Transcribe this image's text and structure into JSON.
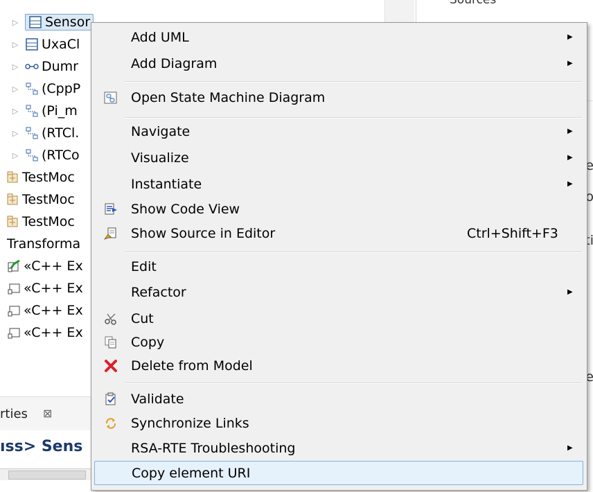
{
  "tree": {
    "items": [
      {
        "label": "Sensor",
        "icon": "class-icon"
      },
      {
        "label": "UxaCl",
        "icon": "class-icon"
      },
      {
        "label": "Dumr",
        "icon": "interface-icon"
      },
      {
        "label": "(CppP",
        "icon": "connector-icon"
      },
      {
        "label": "(Pi_m",
        "icon": "connector-icon"
      },
      {
        "label": "(RTCl.",
        "icon": "connector-icon"
      },
      {
        "label": "(RTCo",
        "icon": "connector-icon"
      },
      {
        "label": "TestMoc",
        "icon": "package-icon"
      },
      {
        "label": "TestMoc",
        "icon": "package-icon"
      },
      {
        "label": "TestMoc",
        "icon": "package-icon"
      },
      {
        "label": "Transforma",
        "icon": ""
      },
      {
        "label": "«C++ Ex",
        "icon": "transform-config-icon"
      },
      {
        "label": "«C++ Ex",
        "icon": "transform-config-icon"
      },
      {
        "label": "«C++ Ex",
        "icon": "transform-config-icon"
      },
      {
        "label": "«C++ Ex",
        "icon": "transform-config-icon"
      }
    ]
  },
  "right_pane": {
    "header": "Sources",
    "fragments": [
      "e",
      "o",
      "ti",
      "e"
    ]
  },
  "bottom": {
    "tab_label": "rties",
    "tab_close": "⊠",
    "title": "ıss> Sens"
  },
  "menu": {
    "items": [
      {
        "label": "Add UML",
        "submenu": true,
        "icon": ""
      },
      {
        "label": "Add Diagram",
        "submenu": true,
        "icon": ""
      },
      {
        "label": "Open State Machine Diagram",
        "icon": "state-machine-diagram-icon"
      },
      {
        "label": "Navigate",
        "submenu": true,
        "icon": ""
      },
      {
        "label": "Visualize",
        "submenu": true,
        "icon": ""
      },
      {
        "label": "Instantiate",
        "submenu": true,
        "icon": ""
      },
      {
        "label": "Show Code View",
        "icon": "code-view-icon"
      },
      {
        "label": "Show Source in Editor",
        "shortcut": "Ctrl+Shift+F3",
        "icon": "source-editor-icon"
      },
      {
        "label": "Edit",
        "icon": ""
      },
      {
        "label": "Refactor",
        "submenu": true,
        "icon": ""
      },
      {
        "label": "Cut",
        "icon": "scissors-icon"
      },
      {
        "label": "Copy",
        "icon": "copy-icon"
      },
      {
        "label": "Delete from Model",
        "icon": "delete-icon"
      },
      {
        "label": "Validate",
        "icon": "validate-icon"
      },
      {
        "label": "Synchronize Links",
        "icon": "sync-icon"
      },
      {
        "label": "RSA-RTE Troubleshooting",
        "submenu": true,
        "icon": ""
      },
      {
        "label": "Copy element URI",
        "icon": "",
        "highlighted": true
      }
    ]
  },
  "colors": {
    "menu_bg": "#f0f0f0",
    "highlight": "#e5f1fb",
    "highlight_border": "#7fb2e0",
    "delete_red": "#d9202a"
  }
}
